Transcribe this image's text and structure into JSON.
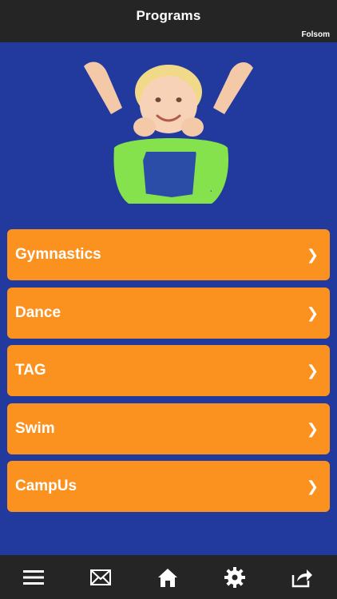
{
  "header": {
    "title": "Programs",
    "location": "Folsom"
  },
  "menu": {
    "items": [
      {
        "label": "Gymnastics",
        "chevron": "❯"
      },
      {
        "label": "Dance",
        "chevron": "❯"
      },
      {
        "label": "TAG",
        "chevron": "❯"
      },
      {
        "label": "Swim",
        "chevron": "❯"
      },
      {
        "label": "CampUs",
        "chevron": "❯"
      }
    ]
  },
  "tabbar": {
    "icons": [
      "hamburger-menu-icon",
      "envelope-icon",
      "home-icon",
      "gear-icon",
      "share-icon"
    ]
  },
  "colors": {
    "background": "#223a9e",
    "button": "#fb9220",
    "bars": "#252525"
  }
}
